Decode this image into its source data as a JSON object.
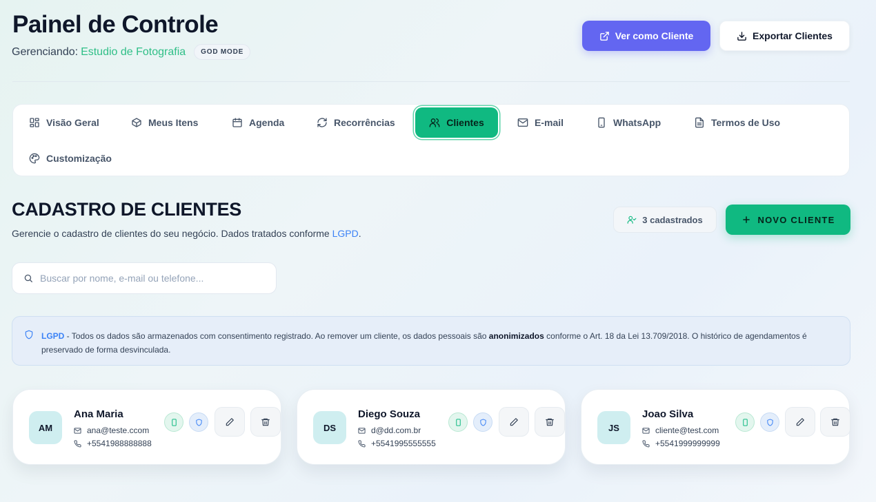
{
  "header": {
    "title": "Painel de Controle",
    "managing_label": "Gerenciando:",
    "business_name": "Estudio de Fotografia",
    "mode_badge": "GOD MODE",
    "view_as_client": "Ver como Cliente",
    "export_clients": "Exportar Clientes"
  },
  "tabs": [
    {
      "label": "Visão Geral",
      "icon": "grid-icon",
      "active": false
    },
    {
      "label": "Meus Itens",
      "icon": "box-icon",
      "active": false
    },
    {
      "label": "Agenda",
      "icon": "calendar-icon",
      "active": false
    },
    {
      "label": "Recorrências",
      "icon": "refresh-icon",
      "active": false
    },
    {
      "label": "Clientes",
      "icon": "users-icon",
      "active": true
    },
    {
      "label": "E-mail",
      "icon": "mail-icon",
      "active": false
    },
    {
      "label": "WhatsApp",
      "icon": "phone-device-icon",
      "active": false
    },
    {
      "label": "Termos de Uso",
      "icon": "document-icon",
      "active": false
    },
    {
      "label": "Customização",
      "icon": "palette-icon",
      "active": false
    }
  ],
  "section": {
    "title": "CADASTRO DE CLIENTES",
    "subtitle_prefix": "Gerencie o cadastro de clientes do seu negócio. Dados tratados conforme ",
    "subtitle_link": "LGPD",
    "subtitle_suffix": ".",
    "count_label": "3 cadastrados",
    "new_client_button": "NOVO CLIENTE"
  },
  "search": {
    "placeholder": "Buscar por nome, e-mail ou telefone..."
  },
  "notice": {
    "tag": "LGPD",
    "text_a": " - Todos os dados são armazenados com consentimento registrado. Ao remover um cliente, os dados pessoais são ",
    "bold": "anonimizados",
    "text_b": " conforme o Art. 18 da Lei 13.709/2018. O histórico de agendamentos é preservado de forma desvinculada."
  },
  "clients": [
    {
      "initials": "AM",
      "name": "Ana Maria",
      "email": "ana@teste.ccom",
      "phone": "+5541988888888"
    },
    {
      "initials": "DS",
      "name": "Diego Souza",
      "email": "d@dd.com.br",
      "phone": "+5541995555555"
    },
    {
      "initials": "JS",
      "name": "Joao Silva",
      "email": "cliente@test.com",
      "phone": "+5541999999999"
    }
  ],
  "colors": {
    "primary_green": "#10b981",
    "indigo": "#6366f1",
    "link_blue": "#3b82f6",
    "business_green": "#2fbf87"
  }
}
